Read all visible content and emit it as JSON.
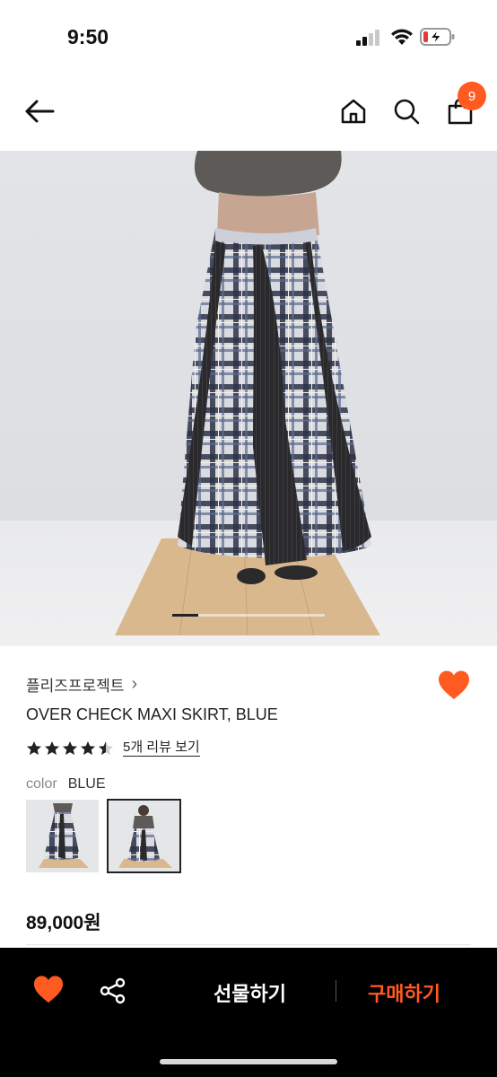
{
  "status_bar": {
    "time": "9:50"
  },
  "nav": {
    "cart_count": "9"
  },
  "carousel": {
    "progress": 0.17
  },
  "product": {
    "brand": "플리즈프로젝트",
    "brand_chevron": "›",
    "name": "OVER CHECK MAXI SKIRT, BLUE",
    "rating": 4.5,
    "review_link": "5개 리뷰 보기",
    "color_label": "color",
    "color_value": "BLUE",
    "price": "89,000원",
    "thumbnails": [
      "thumbnail-1",
      "thumbnail-2"
    ],
    "selected_thumbnail": 1
  },
  "bottom_bar": {
    "gift_label": "선물하기",
    "buy_label": "구매하기"
  },
  "colors": {
    "accent": "#ff5a1f",
    "bottom_bar": "#000000",
    "text": "#222222"
  },
  "icons": [
    "back-arrow-icon",
    "home-icon",
    "search-icon",
    "shopping-bag-icon",
    "heart-icon",
    "share-icon",
    "star-icon",
    "chevron-right-icon"
  ]
}
